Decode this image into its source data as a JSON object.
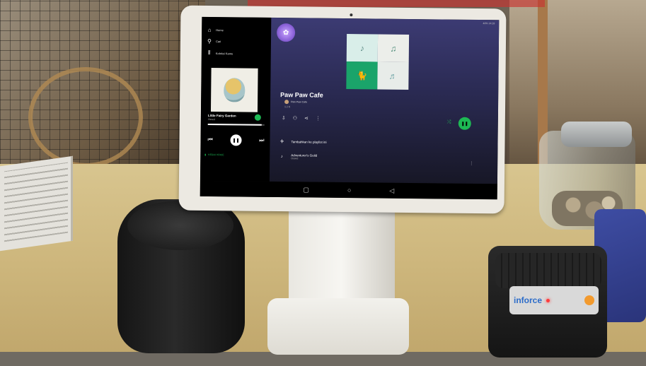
{
  "spotify": {
    "sidebar": {
      "items": [
        {
          "label": "Home",
          "icon": "home-icon"
        },
        {
          "label": "Cari",
          "icon": "search-icon"
        },
        {
          "label": "Koleksi Kamu",
          "icon": "library-icon"
        }
      ],
      "now_playing": {
        "title": "Little Fairy Garden",
        "artist": "Ossed",
        "progress": 0.95
      },
      "device_label": "KEDAI VOICE"
    },
    "playlist": {
      "title": "Paw Paw Cafe",
      "owner": "Paw Paw Cafe",
      "meta": "1,1 K"
    },
    "rows": [
      {
        "title": "Tambahkan ke playlist ini",
        "subtitle": ""
      },
      {
        "title": "Adventurer's Guild",
        "subtitle": "Ossed"
      }
    ],
    "status_bar": "40% 14:28",
    "accent_color": "#1db954"
  },
  "printer": {
    "brand": "inforce"
  }
}
